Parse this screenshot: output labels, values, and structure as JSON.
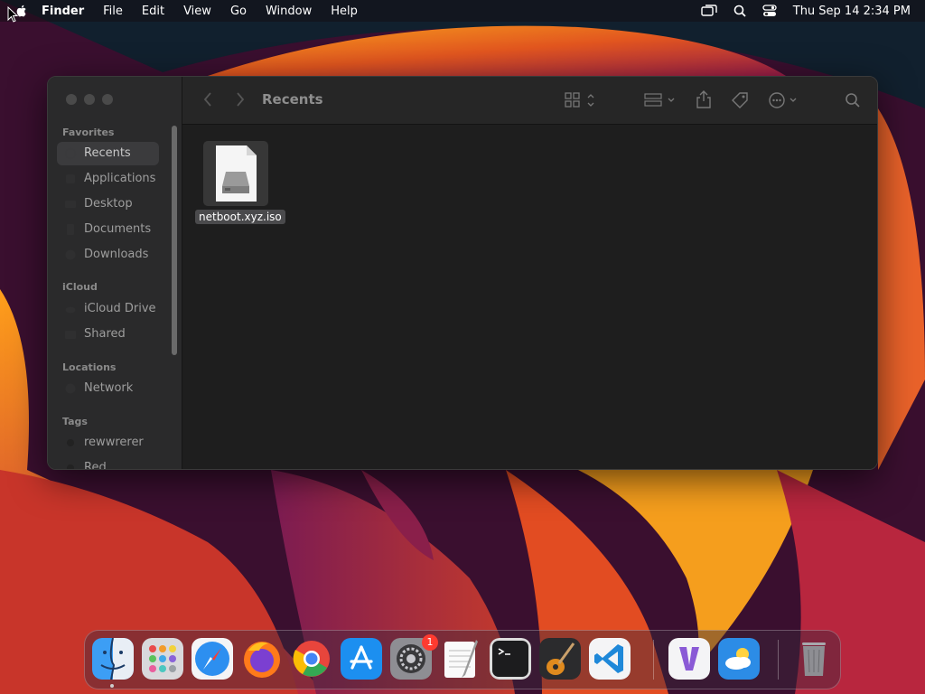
{
  "menubar": {
    "app_name": "Finder",
    "menus": [
      "File",
      "Edit",
      "View",
      "Go",
      "Window",
      "Help"
    ],
    "clock": "Thu Sep 14  2:34 PM"
  },
  "window": {
    "title": "Recents",
    "sidebar": {
      "sections": [
        {
          "label": "Favorites",
          "items": [
            "Recents",
            "Applications",
            "Desktop",
            "Documents",
            "Downloads"
          ]
        },
        {
          "label": "iCloud",
          "items": [
            "iCloud Drive",
            "Shared"
          ]
        },
        {
          "label": "Locations",
          "items": [
            "Network"
          ]
        },
        {
          "label": "Tags",
          "items": [
            "rewwrerer",
            "Red"
          ]
        }
      ],
      "selected": "Recents"
    },
    "files": [
      {
        "name": "netboot.xyz.iso",
        "icon": "disk-image-icon"
      }
    ]
  },
  "dock": {
    "apps": [
      "finder",
      "launchpad",
      "safari",
      "firefox",
      "chrome",
      "app-store",
      "system-settings",
      "textedit",
      "terminal",
      "garageband",
      "vscode",
      "visual-studio",
      "weather",
      "trash"
    ],
    "system_settings_badge": "1"
  }
}
